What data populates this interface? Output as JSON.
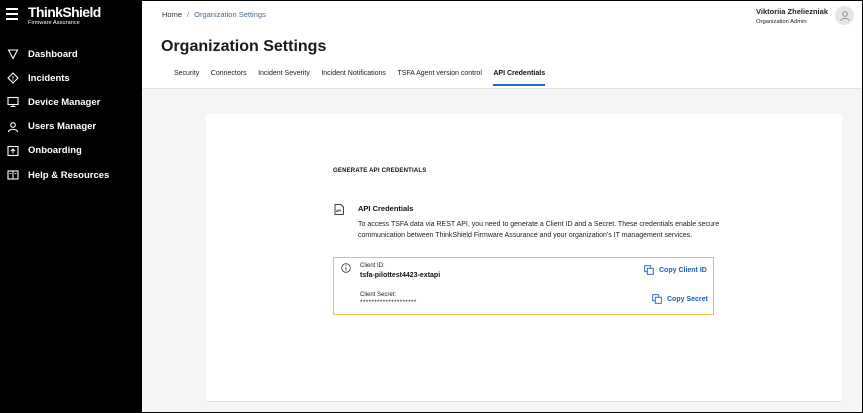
{
  "brand": {
    "name": "ThinkShield",
    "tagline": "Firmware Assurance"
  },
  "sidebar": {
    "items": [
      {
        "label": "Dashboard",
        "icon": "shield-icon"
      },
      {
        "label": "Incidents",
        "icon": "warning-diamond-icon"
      },
      {
        "label": "Device Manager",
        "icon": "monitor-icon"
      },
      {
        "label": "Users Manager",
        "icon": "user-icon"
      },
      {
        "label": "Onboarding",
        "icon": "upload-icon"
      },
      {
        "label": "Help & Resources",
        "icon": "book-icon"
      }
    ]
  },
  "breadcrumb": {
    "home": "Home",
    "separator": "/",
    "current": "Organization Settings"
  },
  "user": {
    "name": "Viktoriia Zheliezniak",
    "role": "Organization Admin"
  },
  "page": {
    "title": "Organization Settings"
  },
  "tabs": [
    {
      "label": "Security",
      "active": false
    },
    {
      "label": "Connectors",
      "active": false
    },
    {
      "label": "Incident Severity",
      "active": false
    },
    {
      "label": "Incident Notifications",
      "active": false
    },
    {
      "label": "TSFA Agent version control",
      "active": false
    },
    {
      "label": "API Credentials",
      "active": true
    }
  ],
  "content": {
    "section_title": "GENERATE API CREDENTIALS",
    "api_title": "API Credentials",
    "api_description": "To access TSFA data via REST API, you need to generate a Client ID and a Secret. These credentials enable secure communication between ThinkShield Firmware Assurance and your organization's IT management services.",
    "credentials": {
      "client_id_label": "Client ID:",
      "client_id_value": "tsfa-pilottest4423-extapi",
      "secret_label": "Client Secret:",
      "secret_value": "********************",
      "copy_id_label": "Copy Client ID",
      "copy_secret_label": "Copy Secret"
    }
  },
  "colors": {
    "accent": "#1f6fc0",
    "link": "#1f5fbf",
    "warning_border": "#f2c04a",
    "sidebar_bg": "#000000"
  }
}
